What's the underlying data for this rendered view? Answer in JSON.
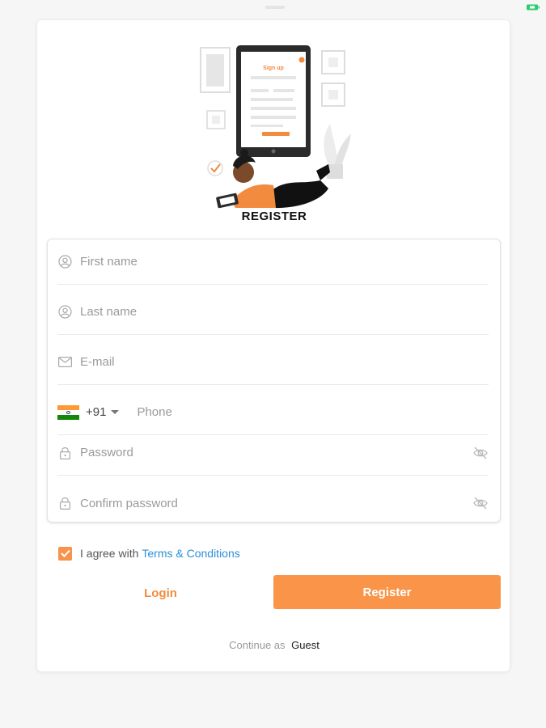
{
  "header": {
    "title": "REGISTER"
  },
  "form": {
    "first_name_placeholder": "First name",
    "last_name_placeholder": "Last name",
    "email_placeholder": "E-mail",
    "country_code": "+91",
    "phone_placeholder": "Phone",
    "password_placeholder": "Password",
    "confirm_password_placeholder": "Confirm password"
  },
  "agree": {
    "checked": true,
    "text": "I agree with",
    "link": "Terms & Conditions"
  },
  "actions": {
    "login_label": "Login",
    "register_label": "Register"
  },
  "guest": {
    "prefix": "Continue as",
    "link": "Guest"
  },
  "illustration_texts": {
    "screen_title": "Sign up"
  },
  "colors": {
    "accent": "#f99448",
    "link": "#2b8fd6",
    "flag_saffron": "#ff9933",
    "flag_green": "#138808"
  },
  "icons": [
    "user-icon",
    "mail-icon",
    "lock-icon",
    "eye-off-icon",
    "india-flag-icon",
    "check-icon",
    "battery-icon"
  ]
}
